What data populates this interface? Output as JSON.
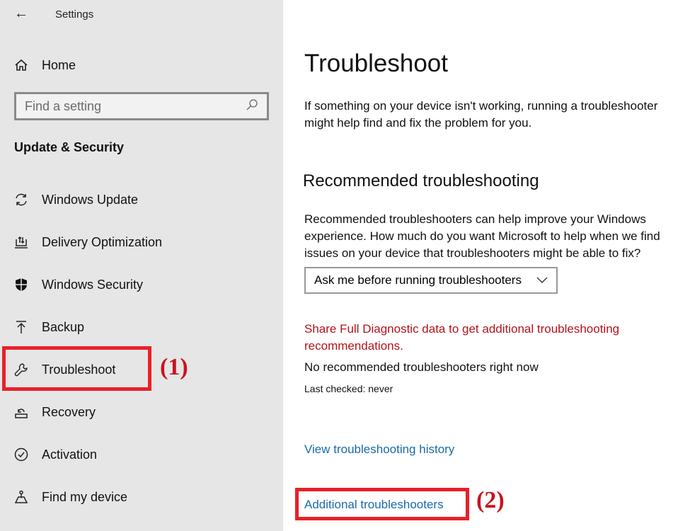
{
  "window": {
    "title": "Settings"
  },
  "sidebar": {
    "home": "Home",
    "search_placeholder": "Find a setting",
    "section": "Update & Security",
    "items": [
      {
        "label": "Windows Update",
        "icon": "sync-icon"
      },
      {
        "label": "Delivery Optimization",
        "icon": "delivery-icon"
      },
      {
        "label": "Windows Security",
        "icon": "shield-icon"
      },
      {
        "label": "Backup",
        "icon": "upload-icon"
      },
      {
        "label": "Troubleshoot",
        "icon": "wrench-icon"
      },
      {
        "label": "Recovery",
        "icon": "recovery-icon"
      },
      {
        "label": "Activation",
        "icon": "check-circle-icon"
      },
      {
        "label": "Find my device",
        "icon": "find-device-icon"
      }
    ]
  },
  "main": {
    "title": "Troubleshoot",
    "intro": "If something on your device isn't working, running a troubleshooter might help find and fix the problem for you.",
    "recommended_heading": "Recommended troubleshooting",
    "recommended_text": "Recommended troubleshooters can help improve your Windows experience. How much do you want Microsoft to help when we find issues on your device that troubleshooters might be able to fix?",
    "dropdown_value": "Ask me before running troubleshooters",
    "diagnostic_link": "Share Full Diagnostic data to get additional troubleshooting recommendations.",
    "none_text": "No recommended troubleshooters right now",
    "last_checked": "Last checked: never",
    "history_link": "View troubleshooting history",
    "additional_link": "Additional troubleshooters"
  },
  "annotations": {
    "step1": "(1)",
    "step2": "(2)",
    "color": "#e8202a"
  }
}
